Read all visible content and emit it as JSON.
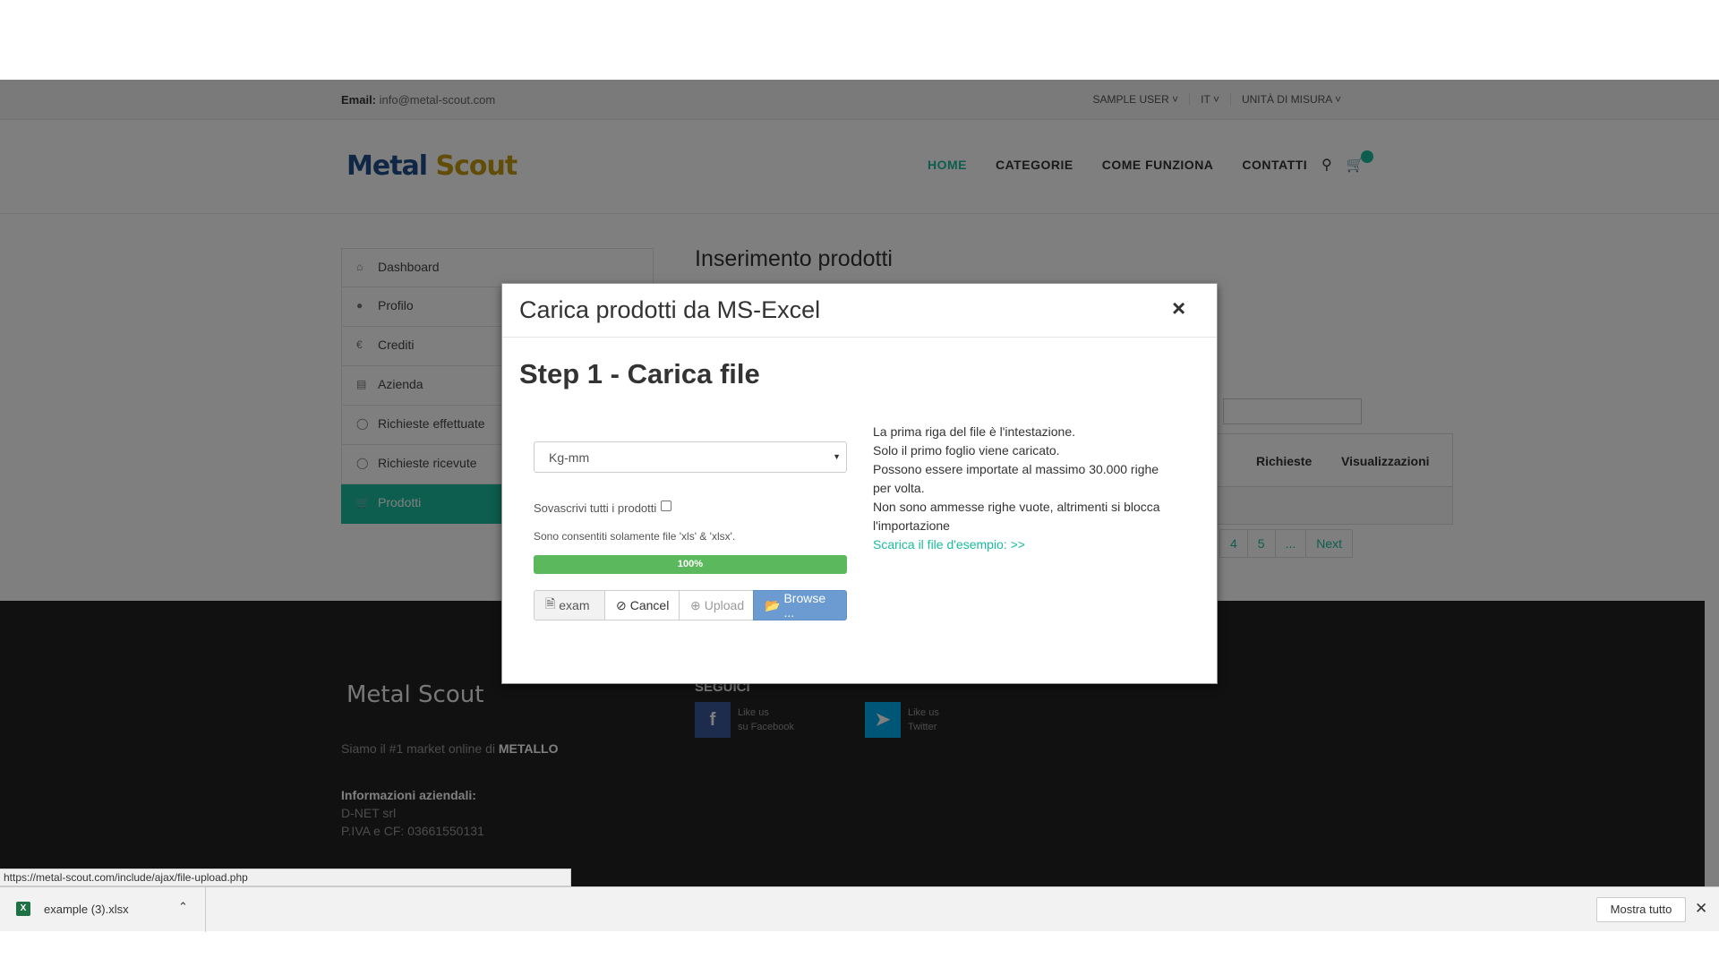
{
  "topbar": {
    "email_label": "Email:",
    "email_value": "info@metal-scout.com",
    "user_menu": "SAMPLE USER",
    "lang_menu": "IT",
    "units_menu": "UNITÀ DI MISURA"
  },
  "header": {
    "logo_part1": "Metal",
    "logo_part2": "Scout",
    "nav": [
      "HOME",
      "CATEGORIE",
      "COME FUNZIONA",
      "CONTATTI"
    ]
  },
  "sidebar": {
    "items": [
      {
        "label": "Dashboard",
        "icon": "home-icon"
      },
      {
        "label": "Profilo",
        "icon": "user-icon"
      },
      {
        "label": "Crediti",
        "icon": "euro-icon"
      },
      {
        "label": "Azienda",
        "icon": "chart-icon"
      },
      {
        "label": "Richieste effettuate",
        "icon": "tag-icon"
      },
      {
        "label": "Richieste ricevute",
        "icon": "tag-icon"
      },
      {
        "label": "Prodotti",
        "icon": "cart-icon"
      }
    ]
  },
  "main": {
    "title": "Inserimento prodotti",
    "table_headers": [
      "Richieste",
      "Visualizzazioni"
    ],
    "pager": [
      "4",
      "5",
      "...",
      "Next"
    ]
  },
  "footer": {
    "logo": "Metal Scout",
    "tagline_pre": "Siamo il #1 market online di ",
    "tagline_bold": "METALLO",
    "info_title": "Informazioni aziendali:",
    "company": "D-NET srl",
    "vat": "P.IVA e CF: 03661550131",
    "follow": "SEGUICI",
    "facebook_line1": "Like us",
    "facebook_line2": "su Facebook",
    "twitter_line1": "Like us",
    "twitter_line2": "Twitter"
  },
  "modal": {
    "title": "Carica prodotti da MS-Excel",
    "close": "×",
    "step_title": "Step 1 - Carica file",
    "unit_select_value": "Kg-mm",
    "overwrite_label": "Sovascrivi tutti i prodotti",
    "allowed_files": "Sono consentiti solamente file 'xls' & 'xlsx'.",
    "progress_text": "100%",
    "progress_fraction": 1.0,
    "file_name": "exam",
    "cancel_label": "Cancel",
    "upload_label": "Upload",
    "browse_label": "Browse ...",
    "instructions": [
      "La prima riga del file è l'intestazione.",
      "Solo il primo foglio viene caricato.",
      "Possono essere importate al massimo 30.000 righe per volta.",
      "Non sono ammesse righe vuote, altrimenti si blocca l'importazione"
    ],
    "download_link": "Scarica il file d'esempio: >>"
  },
  "browser": {
    "status_url": "https://metal-scout.com/include/ajax/file-upload.php",
    "download_file": "example (3).xlsx",
    "show_all": "Mostra tutto"
  },
  "colors": {
    "accent": "#1abc9c",
    "progress": "#5cb85c",
    "browse": "#6b9bd1"
  }
}
